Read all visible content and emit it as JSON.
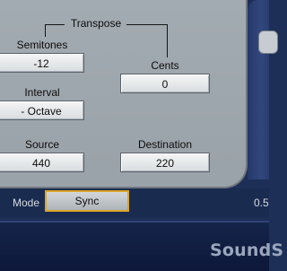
{
  "transpose": {
    "title": "Transpose",
    "semitones_label": "Semitones",
    "semitones_value": "-12",
    "cents_label": "Cents",
    "cents_value": "0",
    "interval_label": "Interval",
    "interval_value": "- Octave"
  },
  "frequency": {
    "source_label": "Source",
    "source_value": "440",
    "destination_label": "Destination",
    "destination_value": "220"
  },
  "mode": {
    "label": "Mode",
    "value": "Sync",
    "right_value": "0.5"
  },
  "brand": {
    "text": "SoundS"
  },
  "colors": {
    "panel": "#9aa2a9",
    "background": "#1d2f56",
    "mode_highlight": "#d9a62a"
  }
}
